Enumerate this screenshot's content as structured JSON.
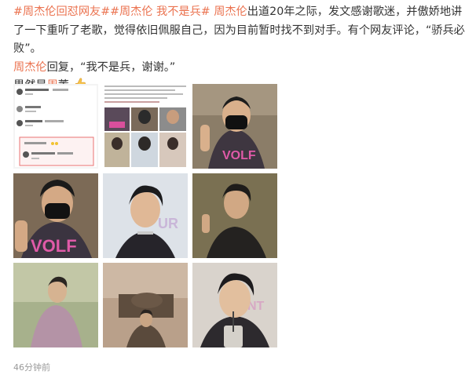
{
  "post": {
    "tag1": "#周杰伦回怼网友#",
    "tag2": "#周杰伦 我不是兵#",
    "mention": "周杰伦",
    "text1": "出道20年之际，发文感谢歌迷，并傲娇地讲了一下重听了老歌，觉得依旧佩服自己，因为目前暂时找不到对手。有个网友评论，“骄兵必败”。",
    "mention2": "周杰伦",
    "text2": "回复，“我不是兵，谢谢。”",
    "text3_a": "果然是",
    "text3_hl": "周",
    "text3_b": "董"
  },
  "images": [
    {
      "label": "微博评论截图",
      "desc": "screenshot"
    },
    {
      "label": "照片2",
      "desc": "photo"
    },
    {
      "label": "照片3",
      "desc": "photo"
    },
    {
      "label": "照片4",
      "desc": "photo"
    },
    {
      "label": "照片5",
      "desc": "photo"
    },
    {
      "label": "照片6",
      "desc": "photo"
    },
    {
      "label": "照片7",
      "desc": "photo"
    },
    {
      "label": "照片8",
      "desc": "photo"
    },
    {
      "label": "照片9",
      "desc": "photo"
    }
  ],
  "timestamp": "46分钟前",
  "colors": {
    "link": "#eb7350",
    "text": "#333333",
    "muted": "#999999"
  }
}
